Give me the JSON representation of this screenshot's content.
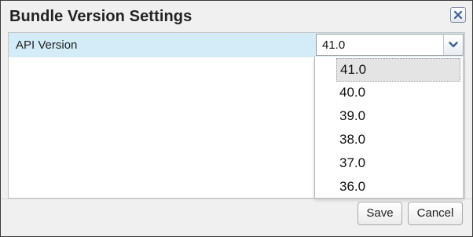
{
  "dialog": {
    "title": "Bundle Version Settings",
    "close_icon": "close-icon"
  },
  "settings": {
    "row_label": "API Version",
    "selected_value": "41.0",
    "dropdown_icon": "chevron-down-icon"
  },
  "dropdown": {
    "options": [
      "41.0",
      "40.0",
      "39.0",
      "38.0",
      "37.0",
      "36.0"
    ],
    "highlighted": "41.0"
  },
  "footer": {
    "save_label": "Save",
    "cancel_label": "Cancel"
  },
  "colors": {
    "row_highlight": "#d3ecf8",
    "dialog_background": "#f0f0f0",
    "icon_blue": "#3b5f93"
  }
}
